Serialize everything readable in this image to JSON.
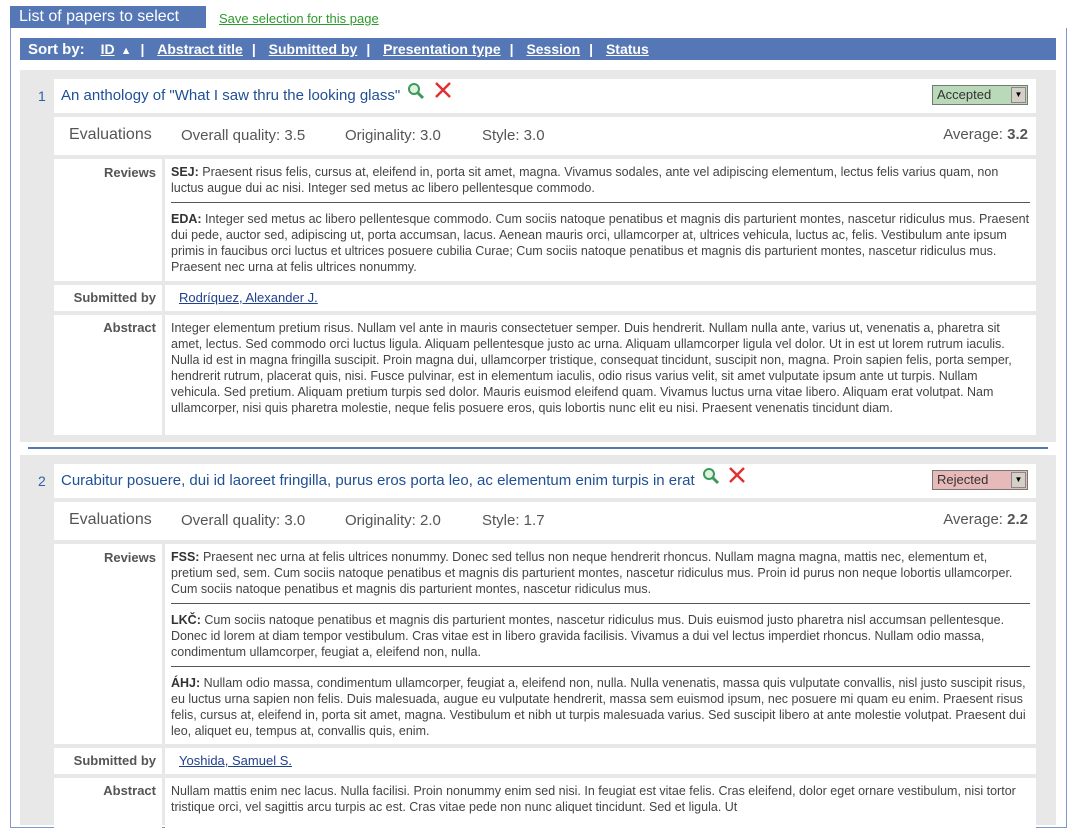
{
  "header": {
    "title": "List of papers to select",
    "save_link": "Save selection for this page"
  },
  "sortbar": {
    "label": "Sort by:",
    "items": [
      "ID",
      "Abstract title",
      "Submitted by",
      "Presentation type",
      "Session",
      "Status"
    ],
    "active_arrow": "▲"
  },
  "labels": {
    "evaluations": "Evaluations",
    "reviews": "Reviews",
    "submitted_by": "Submitted by",
    "abstract": "Abstract"
  },
  "papers": [
    {
      "num": "1",
      "title": "An anthology of \"What I saw thru the looking glass\"",
      "status": "Accepted",
      "status_color": "#b9d9b9",
      "eval": {
        "quality": "Overall quality: 3.5",
        "originality": "Originality: 3.0",
        "style": "Style: 3.0",
        "average_label": "Average:",
        "average": "3.2"
      },
      "reviews": [
        {
          "code": "SEJ:",
          "text": "Praesent risus felis, cursus at, eleifend in, porta sit amet, magna. Vivamus sodales, ante vel adipiscing elementum, lectus felis varius quam, non luctus augue dui ac nisi. Integer sed metus ac libero pellentesque commodo."
        },
        {
          "code": "EDA:",
          "text": "Integer sed metus ac libero pellentesque commodo. Cum sociis natoque penatibus et magnis dis parturient montes, nascetur ridiculus mus. Praesent dui pede, auctor sed, adipiscing ut, porta accumsan, lacus. Aenean mauris orci, ullamcorper at, ultrices vehicula, luctus ac, felis. Vestibulum ante ipsum primis in faucibus orci luctus et ultrices posuere cubilia Curae; Cum sociis natoque penatibus et magnis dis parturient montes, nascetur ridiculus mus. Praesent nec urna at felis ultrices nonummy."
        }
      ],
      "submitted_by": "Rodríquez, Alexander J.",
      "abstract": "Integer elementum pretium risus. Nullam vel ante in mauris consectetuer semper. Duis hendrerit. Nullam nulla ante, varius ut, venenatis a, pharetra sit amet, lectus. Sed commodo orci luctus ligula. Aliquam pellentesque justo ac urna. Aliquam ullamcorper ligula vel dolor. Ut in est ut lorem rutrum iaculis. Nulla id est in magna fringilla suscipit. Proin magna dui, ullamcorper tristique, consequat tincidunt, suscipit non, magna. Proin sapien felis, porta semper, hendrerit rutrum, placerat quis, nisi. Fusce pulvinar, est in elementum iaculis, odio risus varius velit, sit amet vulputate ipsum ante ut turpis. Nullam vehicula. Sed pretium. Aliquam pretium turpis sed dolor. Mauris euismod eleifend quam. Vivamus luctus urna vitae libero. Aliquam erat volutpat. Nam ullamcorper, nisi quis pharetra molestie, neque felis posuere eros, quis lobortis nunc elit eu nisi. Praesent venenatis tincidunt diam."
    },
    {
      "num": "2",
      "title": "Curabitur posuere, dui id laoreet fringilla, purus eros porta leo, ac elementum enim turpis in erat",
      "status": "Rejected",
      "status_color": "#e8b9b9",
      "eval": {
        "quality": "Overall quality: 3.0",
        "originality": "Originality: 2.0",
        "style": "Style: 1.7",
        "average_label": "Average:",
        "average": "2.2"
      },
      "reviews": [
        {
          "code": "FSS:",
          "text": "Praesent nec urna at felis ultrices nonummy. Donec sed tellus non neque hendrerit rhoncus. Nullam magna magna, mattis nec, elementum et, pretium sed, sem. Cum sociis natoque penatibus et magnis dis parturient montes, nascetur ridiculus mus. Proin id purus non neque lobortis ullamcorper. Cum sociis natoque penatibus et magnis dis parturient montes, nascetur ridiculus mus."
        },
        {
          "code": "LKČ:",
          "text": "Cum sociis natoque penatibus et magnis dis parturient montes, nascetur ridiculus mus. Duis euismod justo pharetra nisl accumsan pellentesque. Donec id lorem at diam tempor vestibulum. Cras vitae est in libero gravida facilisis. Vivamus a dui vel lectus imperdiet rhoncus. Nullam odio massa, condimentum ullamcorper, feugiat a, eleifend non, nulla."
        },
        {
          "code": "ÁHJ:",
          "text": "Nullam odio massa, condimentum ullamcorper, feugiat a, eleifend non, nulla. Nulla venenatis, massa quis vulputate convallis, nisl justo suscipit risus, eu luctus urna sapien non felis. Duis malesuada, augue eu vulputate hendrerit, massa sem euismod ipsum, nec posuere mi quam eu enim. Praesent risus felis, cursus at, eleifend in, porta sit amet, magna. Vestibulum et nibh ut turpis malesuada varius. Sed suscipit libero at ante molestie volutpat. Praesent dui leo, aliquet eu, tempus at, convallis quis, enim."
        }
      ],
      "submitted_by": "Yoshida, Samuel S.",
      "abstract": "Nullam mattis enim nec lacus. Nulla facilisi. Proin nonummy enim sed nisi. In feugiat est vitae felis. Cras eleifend, dolor eget ornare vestibulum, nisi tortor tristique orci, vel sagittis arcu turpis ac est. Cras vitae pede non nunc aliquet tincidunt. Sed et ligula. Ut"
    }
  ]
}
